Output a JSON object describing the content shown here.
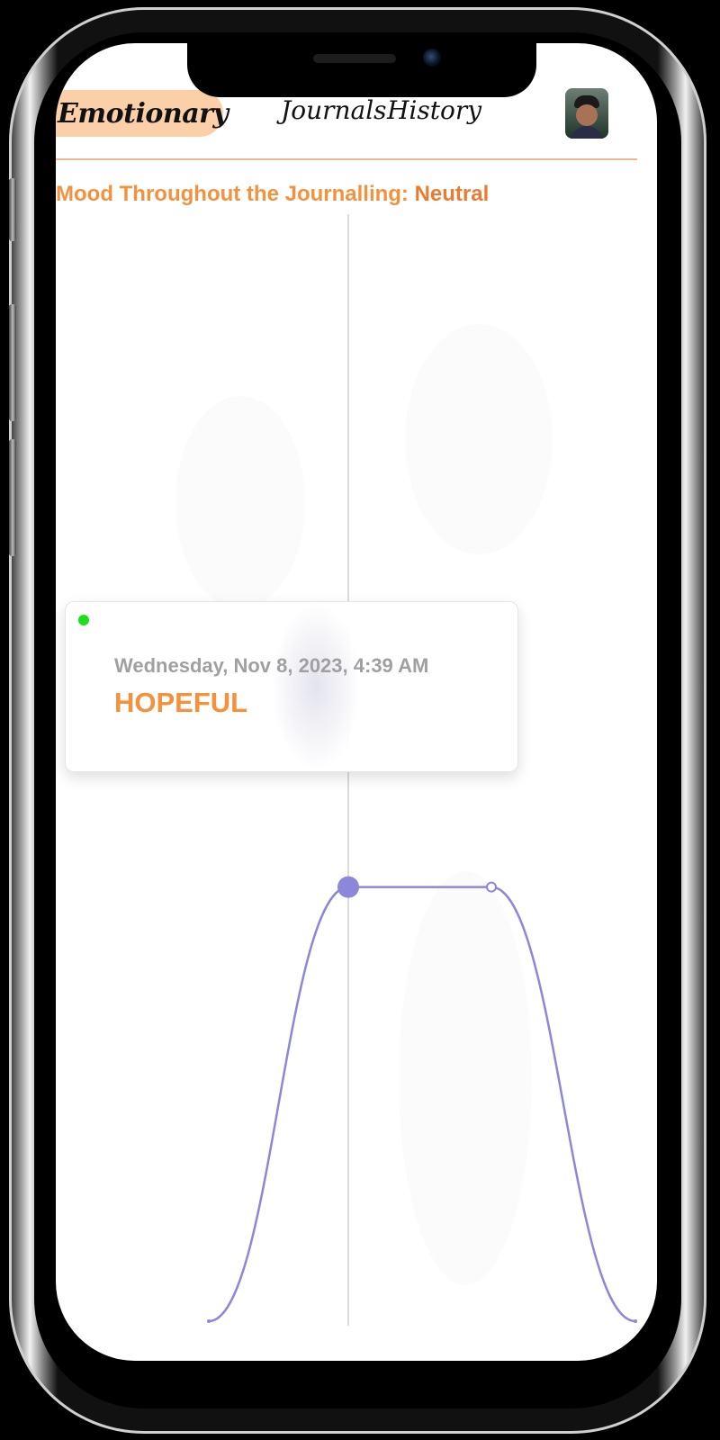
{
  "app": {
    "brand": "Emotionary"
  },
  "nav": {
    "journals": "Journals",
    "history": "History"
  },
  "mood": {
    "label": "Mood Throughout the Journalling:",
    "value": "Neutral"
  },
  "tooltip": {
    "date": "Wednesday, Nov 8, 2023, 4:39 AM",
    "emotion": "HOPEFUL",
    "status_color": "#19e019"
  },
  "colors": {
    "brand_highlight": "#fbd0a9",
    "accent_orange": "#f3913d",
    "line_color": "#8c87d8",
    "divider": "#f3b58a"
  },
  "chart_data": {
    "type": "line",
    "title": "",
    "xlabel": "",
    "ylabel": "",
    "x": [
      "",
      "Wednesday, Nov 8, 2023, 4:39 AM",
      "",
      ""
    ],
    "series": [
      {
        "values": [
          0,
          1,
          1,
          0
        ]
      }
    ],
    "highlighted_index": 1,
    "ylim": [
      0,
      1.7
    ],
    "grid": false,
    "legend": "none"
  }
}
